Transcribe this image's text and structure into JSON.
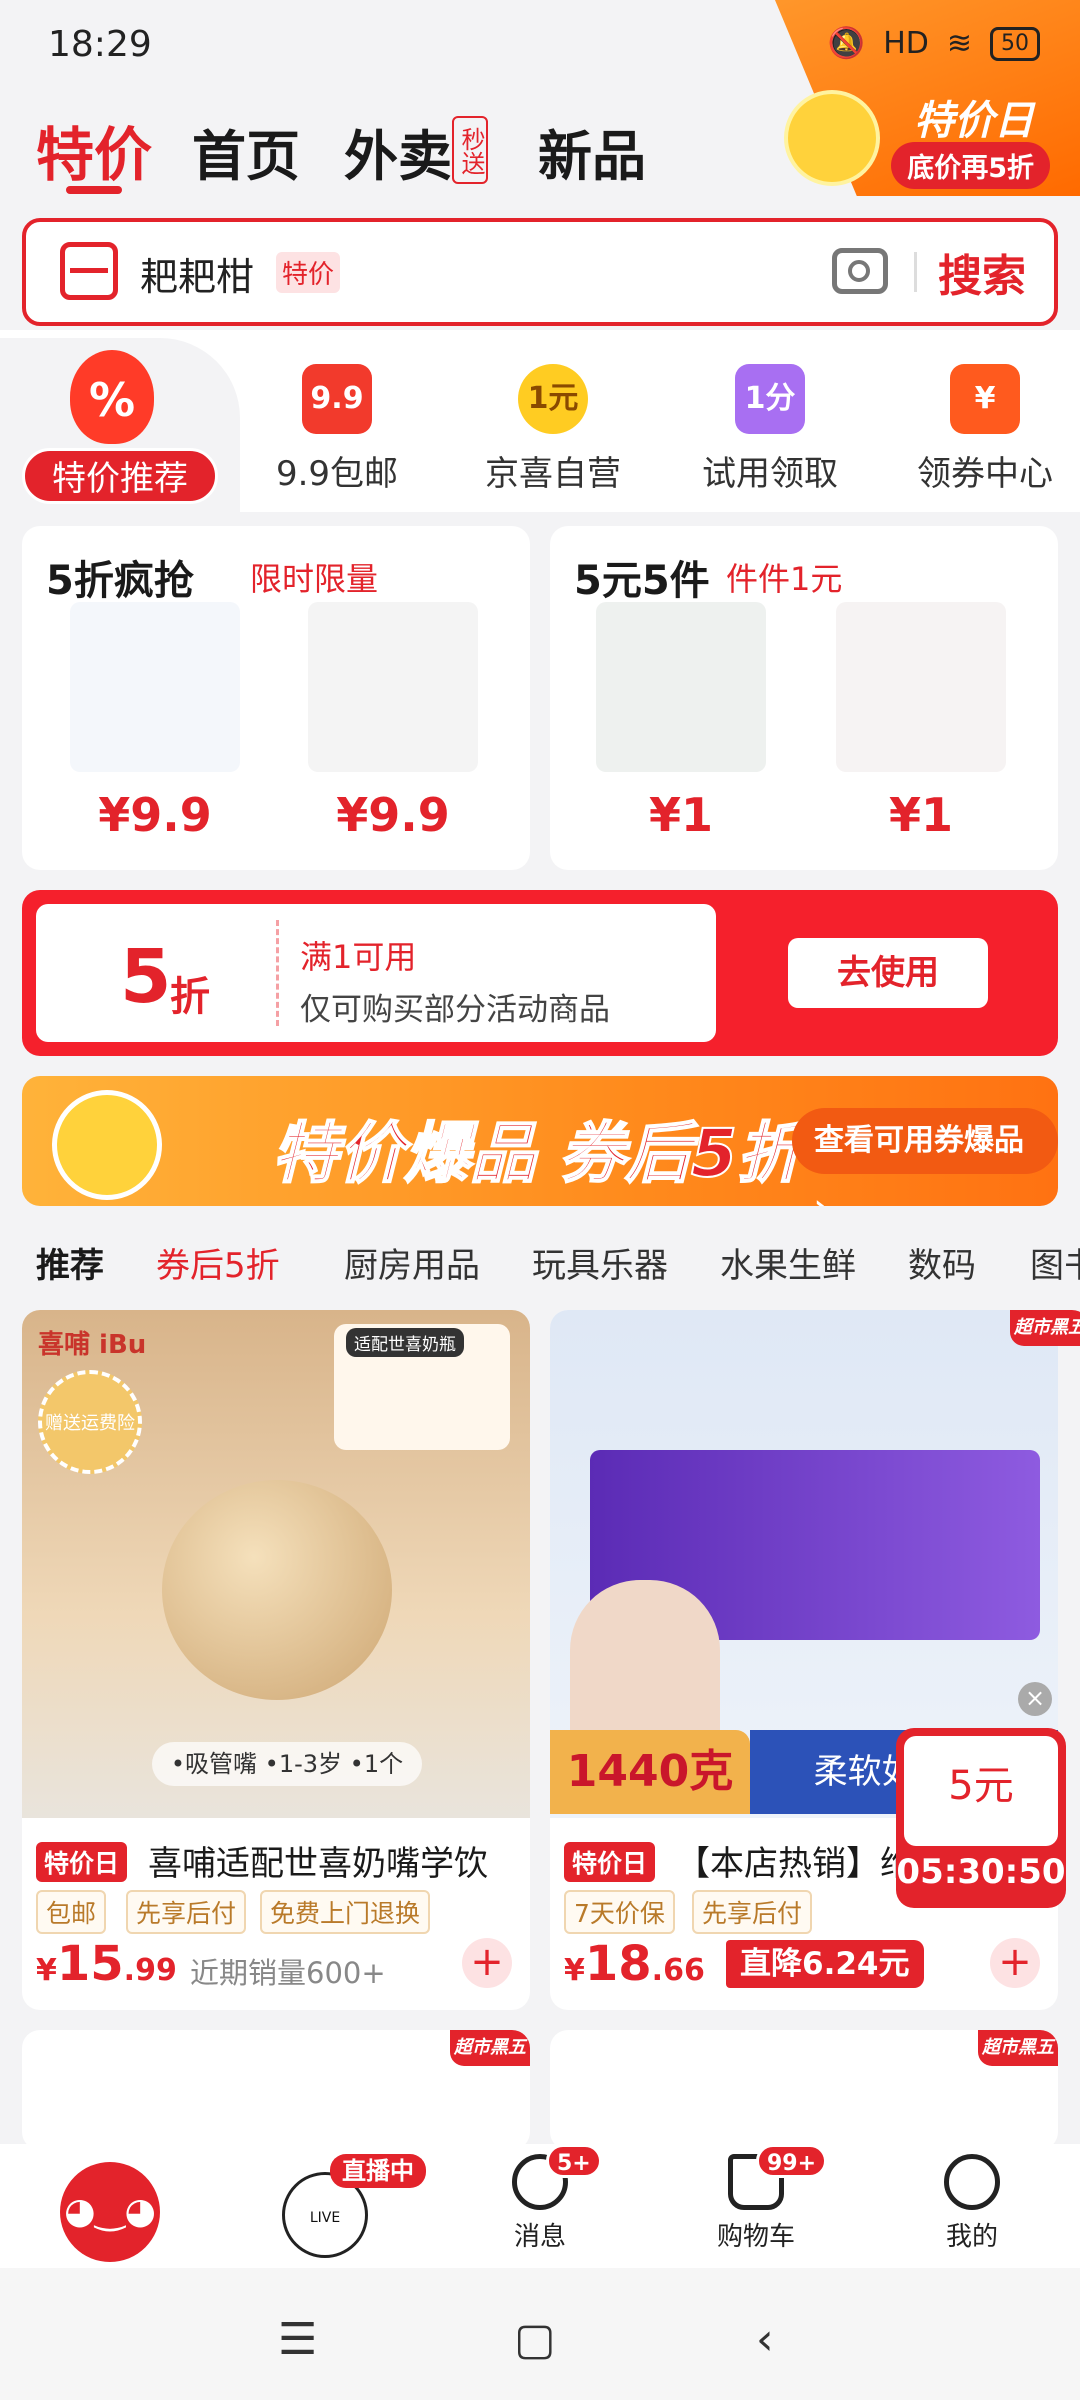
{
  "status": {
    "time": "18:29",
    "battery": "50",
    "network": "HD"
  },
  "header": {
    "tabs": [
      "特价",
      "首页",
      "外卖",
      "新品"
    ],
    "waimai_badge": "秒送",
    "promo_title": "特价日",
    "promo_sub": "底价再5折"
  },
  "search": {
    "text": "耙耙柑",
    "tag": "特价",
    "button": "搜索"
  },
  "categories": [
    {
      "label": "特价推荐",
      "icon": "%"
    },
    {
      "label": "9.9包邮",
      "icon": "9.9"
    },
    {
      "label": "京喜自营",
      "icon": "1元"
    },
    {
      "label": "试用领取",
      "icon": "1分"
    },
    {
      "label": "领券中心",
      "icon": "¥"
    }
  ],
  "deals": [
    {
      "title": "5折疯抢",
      "sub": "限时限量",
      "prices": [
        "¥9.9",
        "¥9.9"
      ]
    },
    {
      "title": "5元5件",
      "sub": "件件1元",
      "prices": [
        "¥1",
        "¥1"
      ]
    }
  ],
  "coupon": {
    "num": "5",
    "unit": "折",
    "line1": "满1可用",
    "line2": "仅可购买部分活动商品",
    "button": "去使用"
  },
  "banner": {
    "text": "特价爆品 券后5折",
    "button": "查看可用券爆品 ›"
  },
  "filter_tabs": [
    "推荐",
    "券后5折",
    "厨房用品",
    "玩具乐器",
    "水果生鲜",
    "数码",
    "图书"
  ],
  "products": [
    {
      "tag": "特价日",
      "name": "喜哺适配世喜奶嘴学饮",
      "badges": [
        "包邮",
        "先享后付",
        "免费上门退换"
      ],
      "currency": "¥",
      "price_int": "15",
      "price_dec": ".99",
      "sales": "近期销量600+",
      "brand": "喜哺 iBu",
      "seal": "赠送运费险",
      "caps_title": "适配世喜奶瓶",
      "features": "•吸管嘴 •1-3岁 •1个"
    },
    {
      "tag": "特价日",
      "name": "【本店热销】维",
      "badges": [
        "7天价保",
        "先享后付"
      ],
      "currency": "¥",
      "price_int": "18",
      "price_dec": ".66",
      "drop": "直降6.24元",
      "market_tag": "超市黑五",
      "weight": "1440克",
      "soft": "柔软如棉 亲"
    }
  ],
  "timer": {
    "amount": "5元",
    "time": "05:30:50"
  },
  "next_row": {
    "tag1": "超市黑五",
    "tag2": "超市黑五"
  },
  "bottom_nav": {
    "live_badge": "直播中",
    "items": [
      {
        "label": "消息",
        "badge": "5+"
      },
      {
        "label": "购物车",
        "badge": "99+"
      },
      {
        "label": "我的",
        "badge": ""
      }
    ]
  },
  "system_nav": {
    "menu": "☰",
    "home": "▢",
    "back": "‹"
  }
}
